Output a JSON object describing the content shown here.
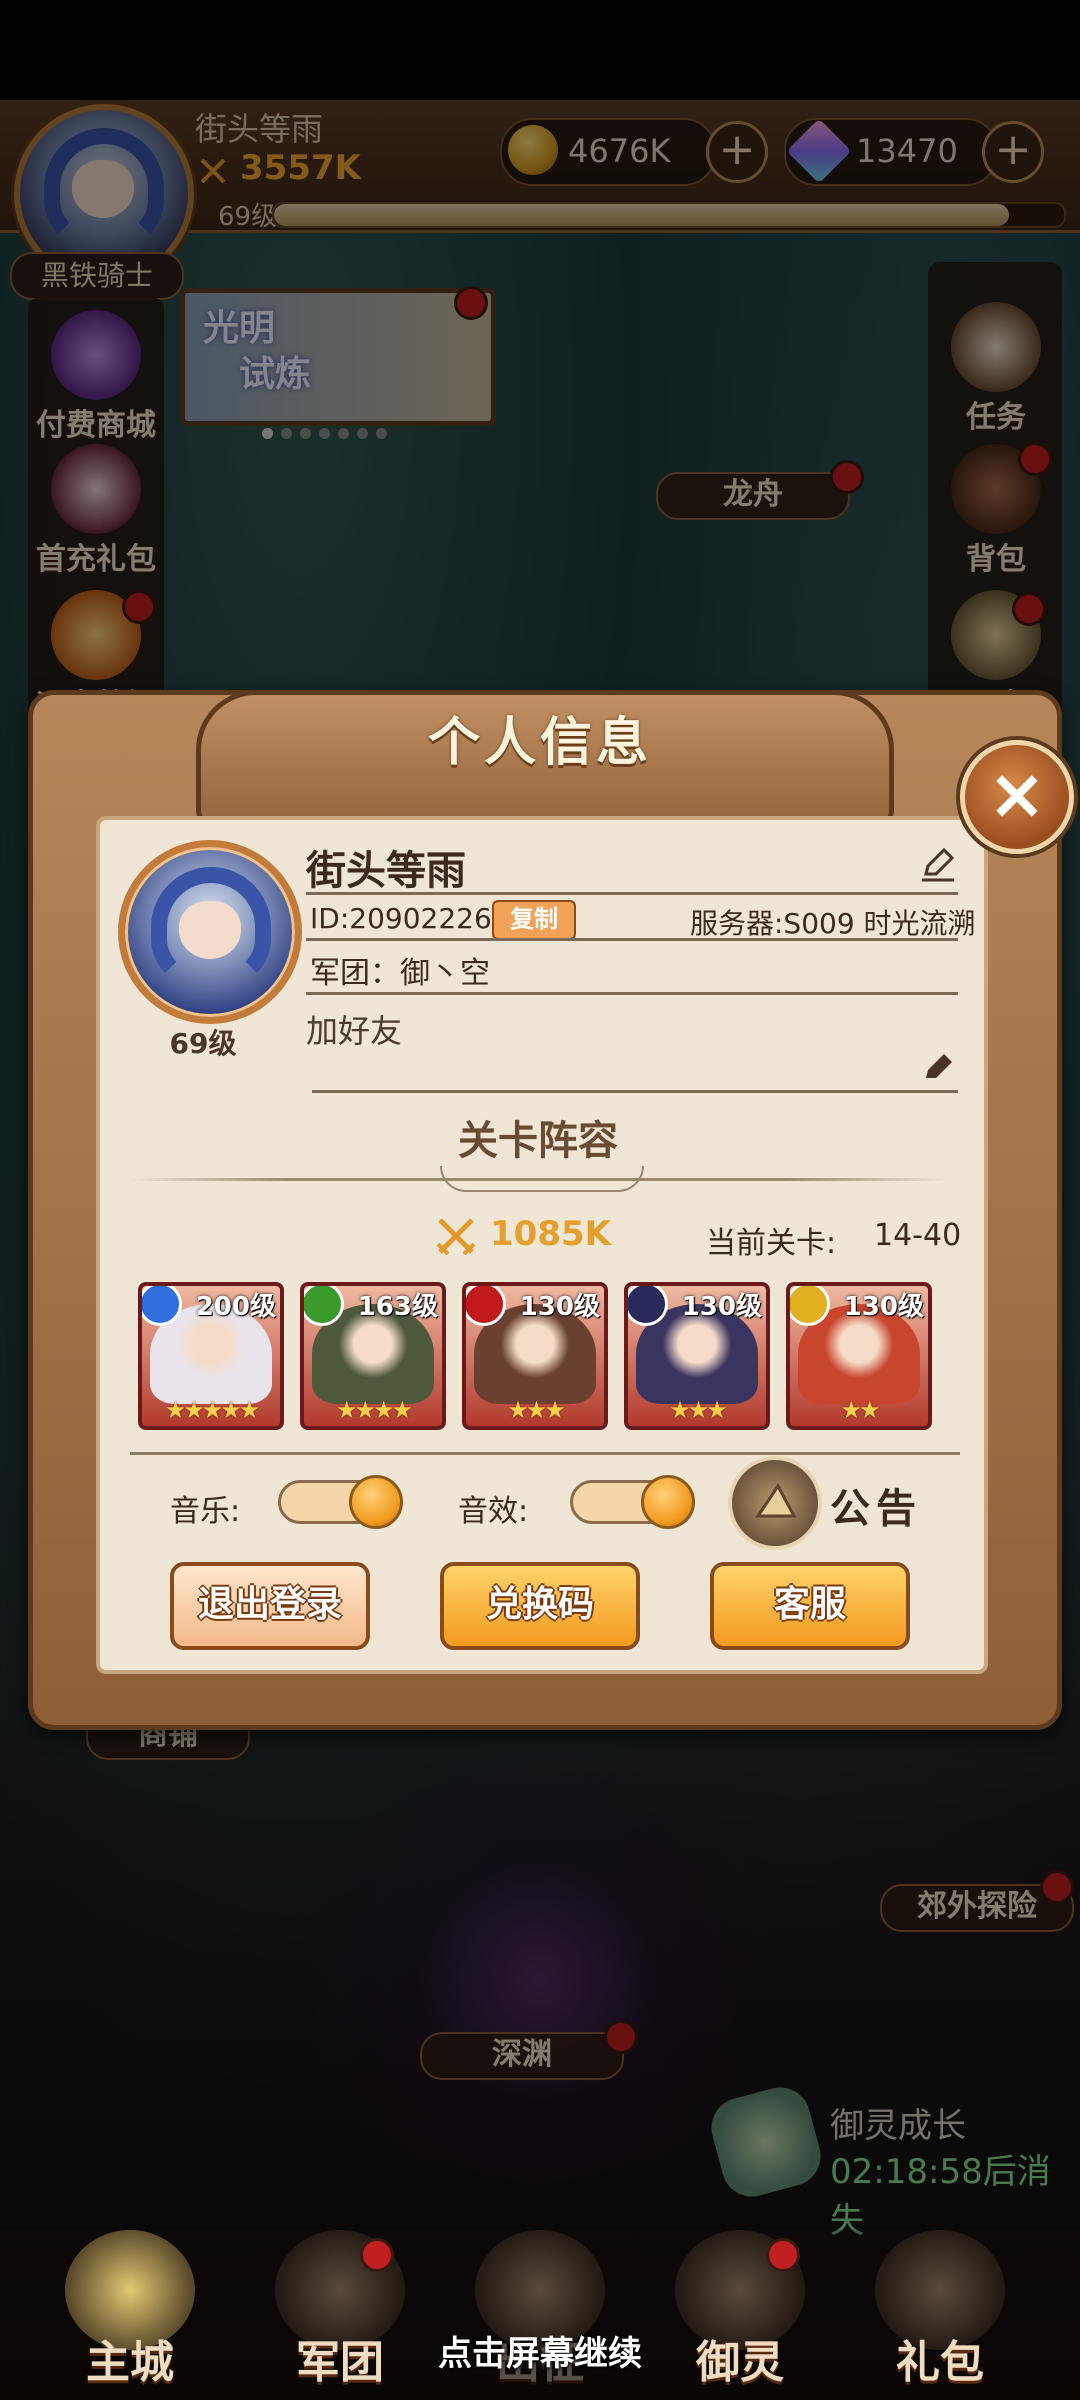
{
  "hud": {
    "player_name": "街头等雨",
    "power": "3557K",
    "level": "69级",
    "title": "黑铁骑士",
    "exp_fraction": 0.93,
    "gold": "4676K",
    "gems": "13470"
  },
  "left_menu": {
    "items": [
      {
        "label": "付费商城"
      },
      {
        "label": "首充礼包"
      },
      {
        "label": "远古战场"
      }
    ]
  },
  "banner": {
    "line1": "光明",
    "line2": "试炼"
  },
  "right_menu": {
    "items": [
      {
        "label": "任务"
      },
      {
        "label": "背包"
      },
      {
        "label": "更多"
      }
    ]
  },
  "scene_labels": {
    "dragon_palace": "龙舟",
    "shop": "商铺",
    "wilds": "郊外探险",
    "abyss": "深渊"
  },
  "dialog": {
    "title": "个人信息",
    "close": "×",
    "profile": {
      "name": "街头等雨",
      "id": "ID:20902226",
      "copy_label": "复制",
      "server": "服务器:S009 时光流溯",
      "guild": "军团：御丶空",
      "signature": "加好友",
      "level": "69级"
    },
    "lineup": {
      "title": "关卡阵容",
      "power": "1085K",
      "stage_label": "当前关卡:",
      "stage_value": "14-40",
      "heroes": [
        {
          "level": "200级",
          "stars": "★★★★★",
          "element_color": "#2f6fe0",
          "art_color": "#e9e4ec"
        },
        {
          "level": "163级",
          "stars": "★★★★",
          "element_color": "#3a9a2a",
          "art_color": "#4f5a3d"
        },
        {
          "level": "130级",
          "stars": "★★★",
          "element_color": "#c21a1a",
          "art_color": "#6a4030"
        },
        {
          "level": "130级",
          "stars": "★★★",
          "element_color": "#2a2a5a",
          "art_color": "#3a3560"
        },
        {
          "level": "130级",
          "stars": "★★",
          "element_color": "#e0b020",
          "art_color": "#c8452e"
        }
      ]
    },
    "settings": {
      "music_label": "音乐:",
      "music_on": true,
      "sfx_label": "音效:",
      "sfx_on": true,
      "notice_label": "公告"
    },
    "buttons": {
      "logout": "退出登录",
      "redeem": "兑换码",
      "support": "客服"
    }
  },
  "event": {
    "label": "御灵成长",
    "timer": "02:18:58后消失"
  },
  "bottom_nav": {
    "items": [
      {
        "label": "主城"
      },
      {
        "label": "军团"
      },
      {
        "label": "出征"
      },
      {
        "label": "御灵"
      },
      {
        "label": "礼包"
      }
    ],
    "hint": "点击屏幕继续"
  }
}
